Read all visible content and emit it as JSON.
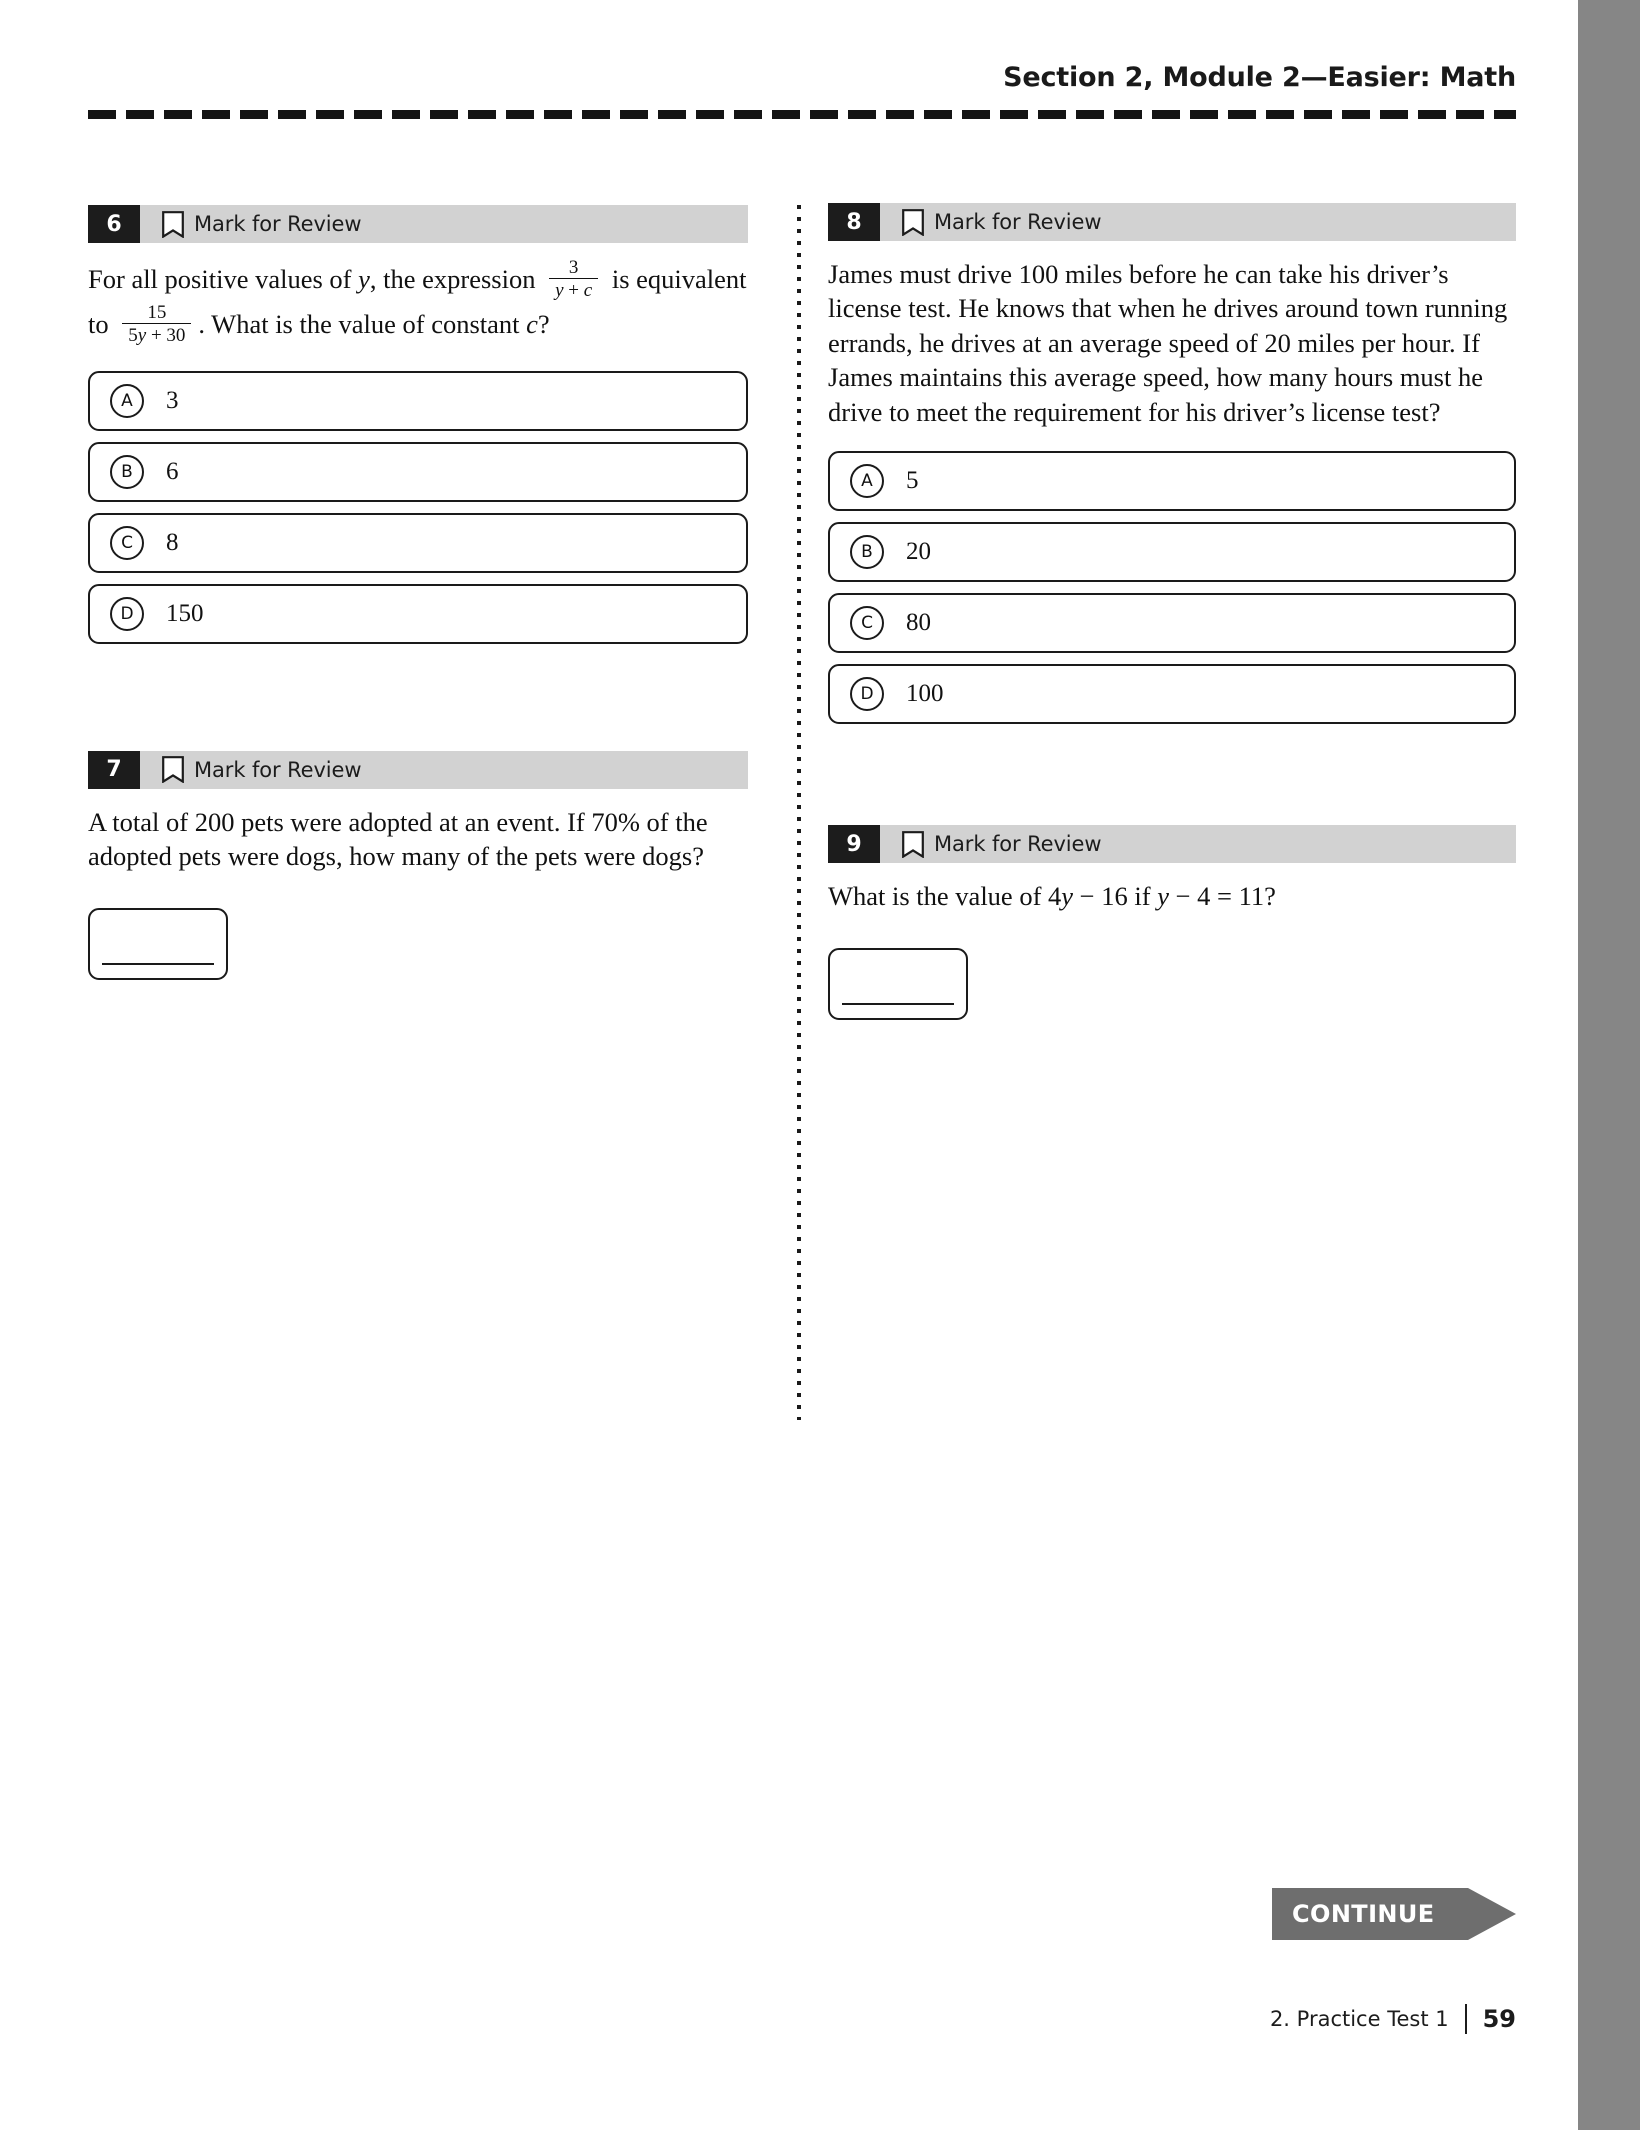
{
  "header": {
    "title": "Section 2, Module 2—Easier: Math"
  },
  "mark_for_review_label": "Mark for Review",
  "questions": [
    {
      "number": "6",
      "column": "left",
      "type": "multiple-choice",
      "text_parts": {
        "p1": "For all positive values of ",
        "var1": "y",
        "p2": ", the expression ",
        "frac1_num": "3",
        "frac1_den_var": "y",
        "frac1_den_op": " + ",
        "frac1_den_var2": "c",
        "p3": " is equivalent to ",
        "frac2_num": "15",
        "frac2_den_n": "5",
        "frac2_den_var": "y",
        "frac2_den_op": " + ",
        "frac2_den_n2": "30",
        "p4": ". What is the value of constant ",
        "var2": "c",
        "p5": "?"
      },
      "choices": [
        {
          "letter": "A",
          "text": "3"
        },
        {
          "letter": "B",
          "text": "6"
        },
        {
          "letter": "C",
          "text": "8"
        },
        {
          "letter": "D",
          "text": "150"
        }
      ]
    },
    {
      "number": "7",
      "column": "left",
      "type": "student-response",
      "text_parts": {
        "p1": "A total of ",
        "n1": "200",
        "p2": " pets were adopted at an event. If ",
        "n2": "70%",
        "p3": " of the adopted pets were dogs, how many of the pets were dogs?"
      }
    },
    {
      "number": "8",
      "column": "right",
      "type": "multiple-choice",
      "text_parts": {
        "p1": "James must drive ",
        "n1": "100",
        "p2": " miles before he can take his driver’s license test. He knows that when he drives around town running errands, he drives at an average speed of ",
        "n2": "20",
        "p3": " miles per hour. If James maintains this average speed, how many hours must he drive to meet the requirement for his driver’s license test?"
      },
      "choices": [
        {
          "letter": "A",
          "text": "5"
        },
        {
          "letter": "B",
          "text": "20"
        },
        {
          "letter": "C",
          "text": "80"
        },
        {
          "letter": "D",
          "text": "100"
        }
      ]
    },
    {
      "number": "9",
      "column": "right",
      "type": "student-response",
      "text_parts": {
        "p1": "What is the value of ",
        "n1": "4",
        "var1": "y",
        "op1": " − ",
        "n2": "16",
        "p2": " if ",
        "var2": "y",
        "op2": " − ",
        "n3": "4",
        "eq": " = ",
        "n4": "11",
        "p3": "?"
      }
    }
  ],
  "continue_button": {
    "label": "CONTINUE"
  },
  "footer": {
    "label": "2.  Practice Test 1",
    "page_number": "59"
  },
  "colors": {
    "qnum_bg": "#1c1c1c",
    "qbar_bg": "#d2d2d2",
    "continue_bg": "#6e6e6e",
    "edge_gray": "#868686"
  }
}
